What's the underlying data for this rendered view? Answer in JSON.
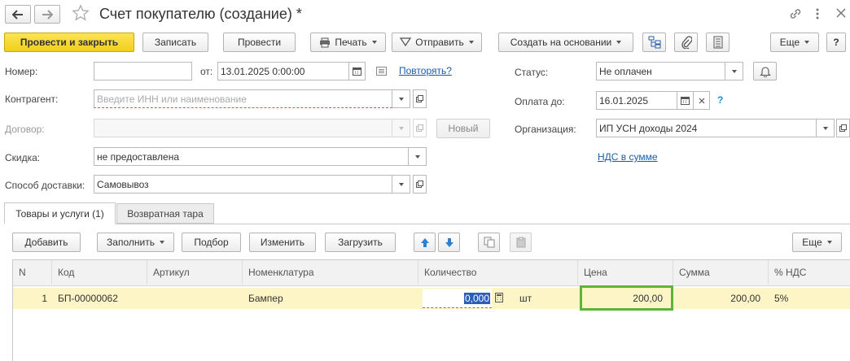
{
  "window": {
    "title": "Счет покупателю (создание) *",
    "icons": [
      "arrow-left-icon",
      "arrow-right-icon",
      "star-icon",
      "link-icon",
      "more-vertical-icon",
      "close-icon"
    ]
  },
  "toolbar": {
    "post_close": "Провести и закрыть",
    "save": "Записать",
    "post": "Провести",
    "print": "Печать",
    "send": "Отправить",
    "create_based": "Создать на основании",
    "more": "Еще",
    "help": "?"
  },
  "form": {
    "number_label": "Номер:",
    "number_value": "",
    "date_from_label": "от:",
    "date_value": "13.01.2025  0:00:00",
    "repeat_link": "Повторять?",
    "counterparty_label": "Контрагент:",
    "counterparty_placeholder": "Введите ИНН или наименование",
    "contract_label": "Договор:",
    "contract_value": "",
    "new_button": "Новый",
    "discount_label": "Скидка:",
    "discount_value": "не предоставлена",
    "delivery_label": "Способ доставки:",
    "delivery_value": "Самовывоз",
    "status_label": "Статус:",
    "status_value": "Не оплачен",
    "pay_until_label": "Оплата до:",
    "pay_until_value": "16.01.2025",
    "pay_until_help": "?",
    "organization_label": "Организация:",
    "organization_value": "ИП УСН доходы 2024",
    "vat_link": "НДС в сумме"
  },
  "tabs": [
    {
      "label": "Товары и услуги (1)",
      "active": true
    },
    {
      "label": "Возвратная тара",
      "active": false
    }
  ],
  "table_toolbar": {
    "add": "Добавить",
    "fill": "Заполнить",
    "select": "Подбор",
    "change": "Изменить",
    "load": "Загрузить",
    "more": "Еще"
  },
  "table": {
    "columns": [
      "N",
      "Код",
      "Артикул",
      "Номенклатура",
      "Количество",
      "Цена",
      "Сумма",
      "% НДС"
    ],
    "rows": [
      {
        "n": "1",
        "code": "БП-00000062",
        "article": "",
        "name": "Бампер",
        "qty": "0,000",
        "unit": "шт",
        "price": "200,00",
        "sum": "200,00",
        "vat": "5%"
      }
    ]
  },
  "colors": {
    "primary_button": "#f5d327",
    "link": "#1a5ca8",
    "selected_row": "#fdf5c6",
    "price_highlight": "#5cb53a",
    "required_underline": "#d9534f"
  }
}
